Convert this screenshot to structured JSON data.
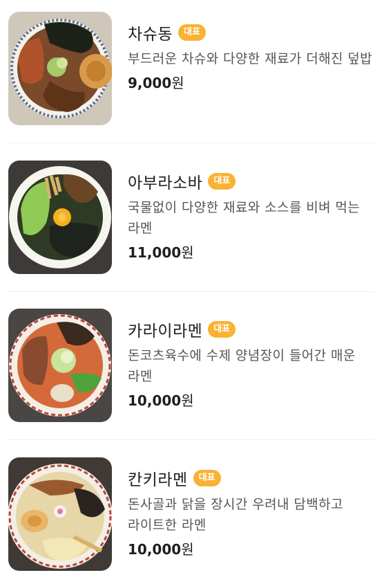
{
  "menu": {
    "items": [
      {
        "name": "차슈동",
        "badge": "대표",
        "description": "부드러운 차슈와 다양한 재료가 더해진 덮밥",
        "price": "9,000",
        "currency": "원",
        "image_icon": "chashu-don-photo"
      },
      {
        "name": "아부라소바",
        "badge": "대표",
        "description": "국물없이 다양한 재료와 소스를 비벼 먹는 라멘",
        "price": "11,000",
        "currency": "원",
        "image_icon": "abura-soba-photo"
      },
      {
        "name": "카라이라멘",
        "badge": "대표",
        "description": "돈코츠육수에 수제 양념장이 들어간 매운 라멘",
        "price": "10,000",
        "currency": "원",
        "image_icon": "karai-ramen-photo"
      },
      {
        "name": "칸키라멘",
        "badge": "대표",
        "description": "돈사골과 닭을 장시간 우려내 담백하고 라이트한 라멘",
        "price": "10,000",
        "currency": "원",
        "image_icon": "kanki-ramen-photo"
      }
    ]
  },
  "colors": {
    "badge": "#f9b233",
    "divider": "#eeeeee",
    "text": "#1e1e1e",
    "description": "#555555"
  }
}
